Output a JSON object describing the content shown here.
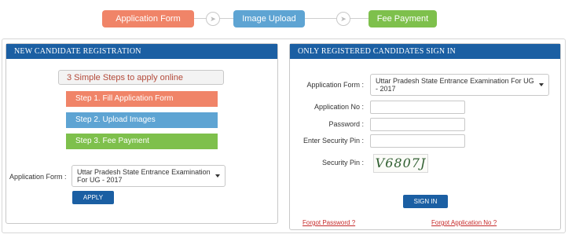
{
  "steps": {
    "step1": "Application Form",
    "step2": "Image Upload",
    "step3": "Fee Payment"
  },
  "left_panel": {
    "title": "NEW CANDIDATE REGISTRATION",
    "steps_heading": "3 Simple Steps to apply online",
    "step_bars": [
      "Step 1. Fill Application Form",
      "Step 2. Upload Images",
      "Step 3. Fee Payment"
    ],
    "form_label": "Application Form :",
    "form_select_value": "Uttar Pradesh State Entrance Examination For UG - 2017",
    "apply_label": "APPLY"
  },
  "right_panel": {
    "title": "ONLY REGISTERED CANDIDATES SIGN IN",
    "form_label": "Application Form :",
    "form_select_value": "Uttar Pradesh State Entrance Examination For UG - 2017",
    "app_no_label": "Application No :",
    "password_label": "Password :",
    "security_pin_label": "Enter Security Pin :",
    "captcha_label": "Security Pin :",
    "captcha_value": "V6807J",
    "signin_label": "SIGN IN"
  },
  "links": {
    "forgot_password": "Forgot Password ?",
    "forgot_application": "Forgot Application No ?"
  },
  "colors": {
    "step1": "#f08468",
    "step2": "#5ea4d3",
    "step3": "#7ec04c",
    "header_blue": "#1b5fa3",
    "link_red": "#c62a2a"
  },
  "icons": {
    "arrow": "chevron-right-icon",
    "dropdown": "caret-down-icon"
  }
}
